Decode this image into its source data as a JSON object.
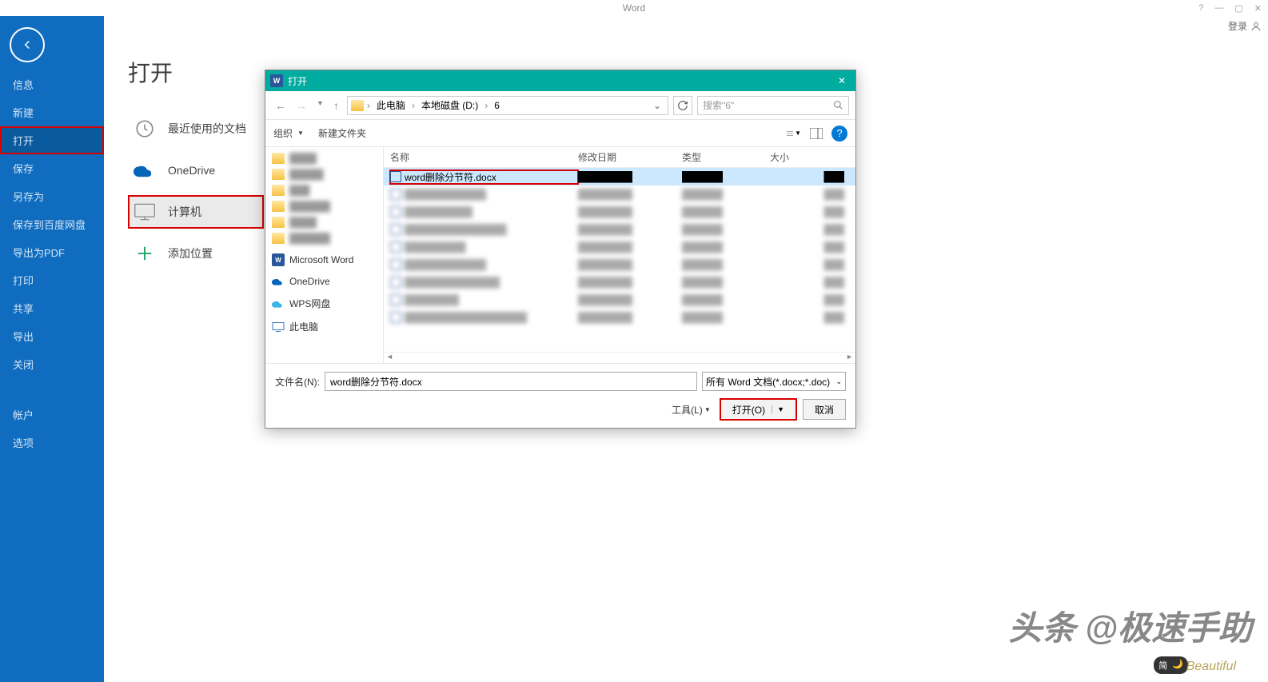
{
  "app": {
    "title": "Word",
    "login": "登录"
  },
  "sidebar": {
    "items": [
      "信息",
      "新建",
      "打开",
      "保存",
      "另存为",
      "保存到百度网盘",
      "导出为PDF",
      "打印",
      "共享",
      "导出",
      "关闭"
    ],
    "bottom": [
      "帐户",
      "选项"
    ],
    "highlighted_index": 2
  },
  "main": {
    "title": "打开",
    "places": [
      {
        "label": "最近使用的文档",
        "icon": "clock"
      },
      {
        "label": "OneDrive",
        "icon": "onedrive"
      },
      {
        "label": "计算机",
        "icon": "computer",
        "highlighted": true
      },
      {
        "label": "添加位置",
        "icon": "plus"
      }
    ]
  },
  "dialog": {
    "title": "打开",
    "breadcrumb": [
      "此电脑",
      "本地磁盘 (D:)",
      "6"
    ],
    "search_placeholder": "搜索\"6\"",
    "toolbar": {
      "organize": "组织",
      "newfolder": "新建文件夹"
    },
    "tree": [
      {
        "label": "",
        "blurred": true
      },
      {
        "label": "",
        "blurred": true
      },
      {
        "label": "",
        "blurred": true
      },
      {
        "label": "",
        "blurred": true
      },
      {
        "label": "",
        "blurred": true
      },
      {
        "label": "",
        "blurred": true
      },
      {
        "label": "Microsoft Word",
        "icon": "word"
      },
      {
        "label": "OneDrive",
        "icon": "onedrive"
      },
      {
        "label": "WPS网盘",
        "icon": "wps"
      },
      {
        "label": "此电脑",
        "icon": "pc"
      }
    ],
    "columns": {
      "name": "名称",
      "date": "修改日期",
      "type": "类型",
      "size": "大小"
    },
    "rows": [
      {
        "name": "word删除分节符.docx",
        "selected": true,
        "highlighted": true
      },
      {
        "blurred": true
      },
      {
        "blurred": true
      },
      {
        "blurred": true
      },
      {
        "blurred": true
      },
      {
        "blurred": true
      },
      {
        "blurred": true
      },
      {
        "blurred": true
      },
      {
        "blurred": true
      }
    ],
    "footer": {
      "fname_label": "文件名(N):",
      "fname_value": "word删除分节符.docx",
      "ftype": "所有 Word 文档(*.docx;*.doc)",
      "tools": "工具(L)",
      "open": "打开(O)",
      "cancel": "取消"
    }
  },
  "watermark": {
    "main": "头条 @极速手助",
    "sub": "Beautiful",
    "theme": "简"
  }
}
